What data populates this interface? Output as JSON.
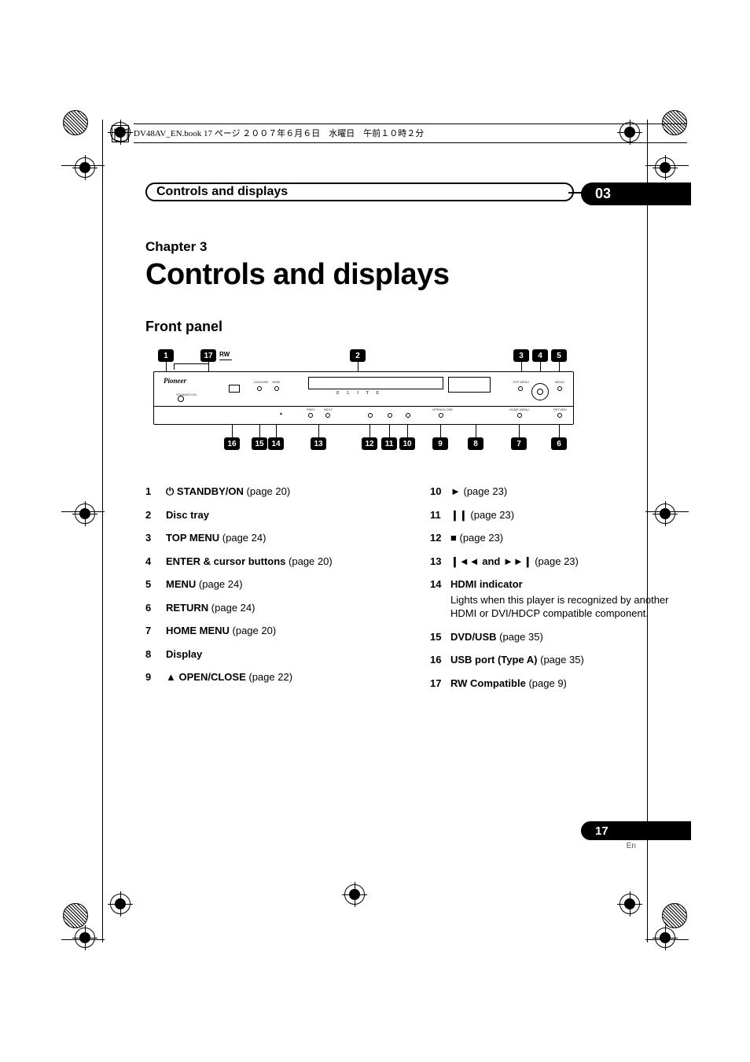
{
  "book_header": "DV48AV_EN.book  17 ページ  ２００７年６月６日　水曜日　午前１０時２分",
  "section_bar_title": "Controls and displays",
  "chapter_number_badge": "03",
  "chapter_label": "Chapter 3",
  "chapter_title": "Controls and displays",
  "section_head": "Front panel",
  "diagram": {
    "top_callouts": [
      "1",
      "17",
      "2",
      "3",
      "4",
      "5"
    ],
    "bottom_callouts": [
      "16",
      "15",
      "14",
      "13",
      "12",
      "11",
      "10",
      "9",
      "8",
      "7",
      "6"
    ],
    "brand": "Pioneer",
    "sub_brand": "E L I T E",
    "rw_label": "RW",
    "labels": {
      "standby": "STANDBY/ON",
      "dvd_usb": "DVD/USB",
      "hdmi": "HDMI",
      "top_menu": "TOP MENU",
      "menu": "MENU",
      "home_menu": "HOME MENU",
      "return": "RETURN",
      "open_close": "OPEN/CLOSE",
      "prev": "PREV",
      "next": "NEXT"
    }
  },
  "left_entries": [
    {
      "num": "1",
      "symbol": "⏻",
      "name": "STANDBY/ON",
      "page": "(page 20)"
    },
    {
      "num": "2",
      "name": "Disc tray"
    },
    {
      "num": "3",
      "name": "TOP MENU",
      "page": "(page 24)"
    },
    {
      "num": "4",
      "name": "ENTER & cursor buttons",
      "page": "(page 20)"
    },
    {
      "num": "5",
      "name": "MENU",
      "page": "(page 24)"
    },
    {
      "num": "6",
      "name": "RETURN",
      "page": "(page 24)"
    },
    {
      "num": "7",
      "name": "HOME MENU",
      "page": "(page 20)"
    },
    {
      "num": "8",
      "name": "Display"
    },
    {
      "num": "9",
      "symbol": "▲",
      "name": "OPEN/CLOSE",
      "page": "(page 22)"
    }
  ],
  "right_entries": [
    {
      "num": "10",
      "symbol": "►",
      "page": "(page 23)"
    },
    {
      "num": "11",
      "symbol": "❙❙",
      "page": "(page 23)"
    },
    {
      "num": "12",
      "symbol": "■",
      "page": "(page 23)"
    },
    {
      "num": "13",
      "symbol": "❙◄◄ and ►►❙",
      "page": "(page 23)"
    },
    {
      "num": "14",
      "name": "HDMI indicator",
      "desc": "Lights when this player is recognized by another HDMI or DVI/HDCP compatible component."
    },
    {
      "num": "15",
      "name": "DVD/USB",
      "page": "(page 35)"
    },
    {
      "num": "16",
      "name": "USB port (Type A)",
      "page": "(page 35)"
    },
    {
      "num": "17",
      "name": "RW Compatible",
      "page": "(page 9)"
    }
  ],
  "footer": {
    "page_num": "17",
    "lang": "En"
  }
}
